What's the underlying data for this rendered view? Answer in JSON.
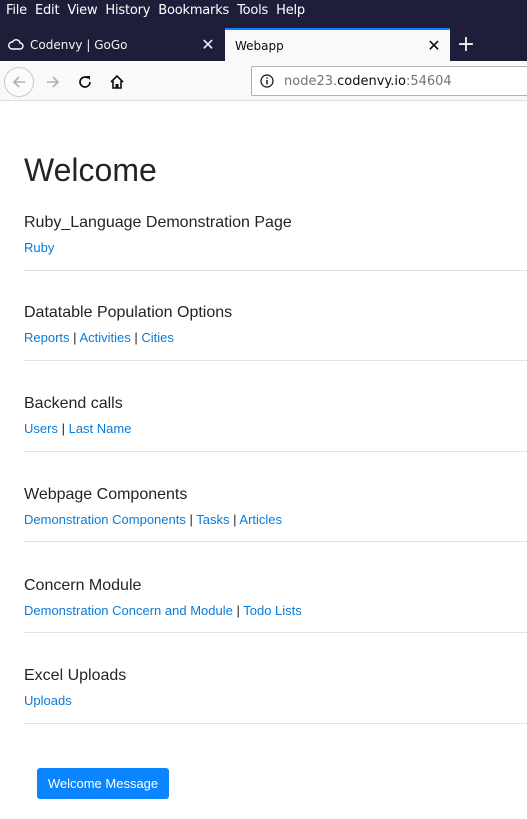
{
  "menu": [
    "File",
    "Edit",
    "View",
    "History",
    "Bookmarks",
    "Tools",
    "Help"
  ],
  "tabs": [
    {
      "title": "Codenvy | GoGo",
      "icon": "cloud-icon",
      "close": "✕"
    },
    {
      "title": "Webapp",
      "close": "✕"
    }
  ],
  "newtab_label": "+",
  "url": {
    "prefix": "node23.",
    "host": "codenvy.io",
    "suffix": ":54604"
  },
  "page": {
    "title": "Welcome",
    "sections": [
      {
        "title": "Ruby_Language Demonstration Page",
        "links": [
          "Ruby"
        ]
      },
      {
        "title": "Datatable Population Options",
        "links": [
          "Reports",
          "Activities",
          "Cities"
        ]
      },
      {
        "title": "Backend calls",
        "links": [
          "Users",
          "Last Name"
        ]
      },
      {
        "title": "Webpage Components",
        "links": [
          "Demonstration Components",
          "Tasks",
          "Articles"
        ]
      },
      {
        "title": "Concern Module",
        "links": [
          "Demonstration Concern and Module",
          "Todo Lists"
        ]
      },
      {
        "title": "Excel Uploads",
        "links": [
          "Uploads"
        ]
      }
    ],
    "separator": "|",
    "button": "Welcome Message"
  },
  "colors": {
    "accent": "#0a84ff",
    "link": "#0a7bd8",
    "chrome": "#1f1e3a"
  }
}
